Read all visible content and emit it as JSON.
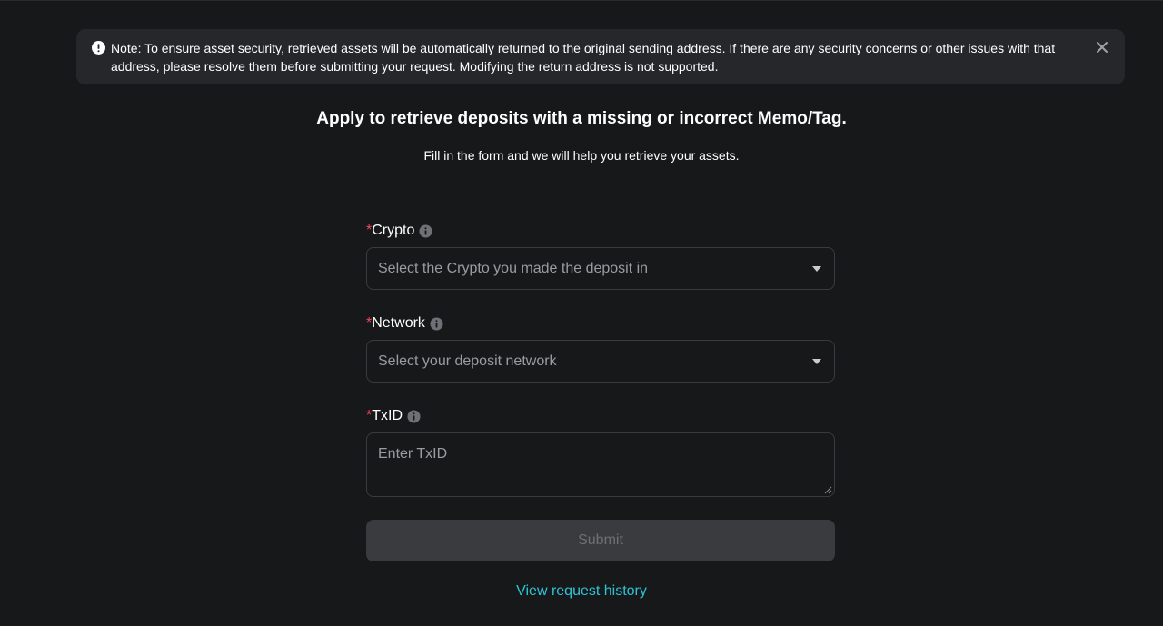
{
  "notice": {
    "icon": "exclamation-circle-icon",
    "text": "Note: To ensure asset security, retrieved assets will be automatically returned to the original sending address. If there are any security concerns or other issues with that address, please resolve them before submitting your request. Modifying the return address is not supported.",
    "close_icon": "close-icon"
  },
  "header": {
    "title": "Apply to retrieve deposits with a missing or incorrect Memo/Tag.",
    "subtitle": "Fill in the form and we will help you retrieve your assets."
  },
  "form": {
    "required_mark": "*",
    "crypto": {
      "label": "Crypto",
      "placeholder": "Select the Crypto you made the deposit in"
    },
    "network": {
      "label": "Network",
      "placeholder": "Select your deposit network"
    },
    "txid": {
      "label": "TxID",
      "placeholder": "Enter TxID"
    },
    "submit_label": "Submit"
  },
  "footer": {
    "history_link": "View request history"
  },
  "colors": {
    "background": "#17181a",
    "banner": "#26272b",
    "required": "#f6465d",
    "link": "#2ec4d6",
    "disabled_button": "#3a3b3f"
  }
}
